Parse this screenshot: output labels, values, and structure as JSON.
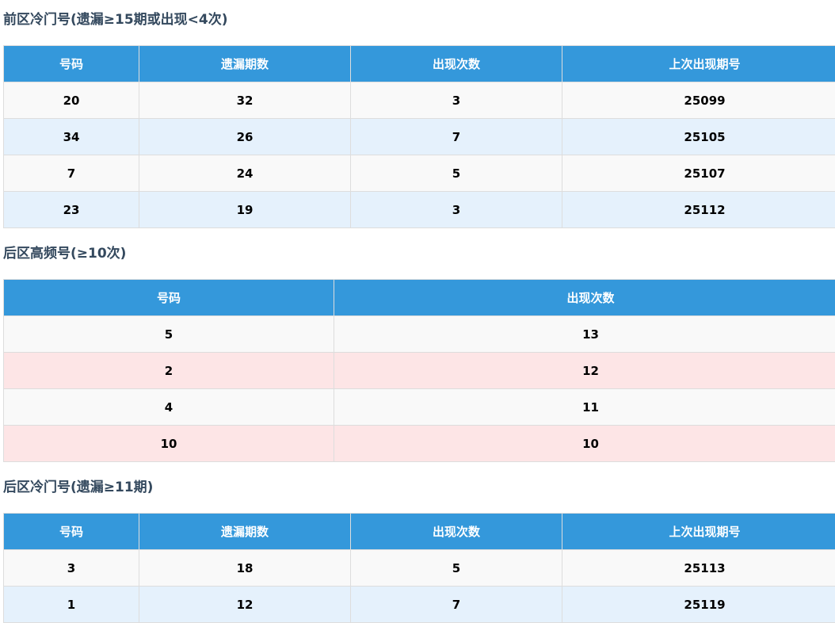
{
  "sections": [
    {
      "title": "前区冷门号(遗漏≥15期或出现<4次)",
      "headers": [
        "号码",
        "遗漏期数",
        "出现次数",
        "上次出现期号"
      ],
      "rows": [
        [
          "20",
          "32",
          "3",
          "25099"
        ],
        [
          "34",
          "26",
          "7",
          "25105"
        ],
        [
          "7",
          "24",
          "5",
          "25107"
        ],
        [
          "23",
          "19",
          "3",
          "25112"
        ]
      ]
    },
    {
      "title": "后区高频号(≥10次)",
      "headers": [
        "号码",
        "出现次数"
      ],
      "rows": [
        [
          "5",
          "13"
        ],
        [
          "2",
          "12"
        ],
        [
          "4",
          "11"
        ],
        [
          "10",
          "10"
        ]
      ]
    },
    {
      "title": "后区冷门号(遗漏≥11期)",
      "headers": [
        "号码",
        "遗漏期数",
        "出现次数",
        "上次出现期号"
      ],
      "rows": [
        [
          "3",
          "18",
          "5",
          "25113"
        ],
        [
          "1",
          "12",
          "7",
          "25119"
        ]
      ]
    }
  ],
  "colors": {
    "header": "#3498db",
    "row_odd": "#f9f9f9",
    "row_blue": "#e5f1fc",
    "row_pink": "#fde5e6",
    "title": "#34495e"
  }
}
